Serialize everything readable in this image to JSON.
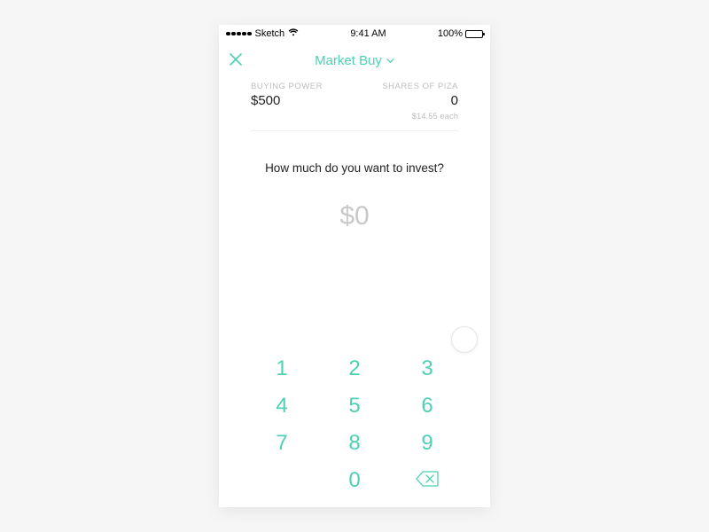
{
  "colors": {
    "accent": "#4ed1b3"
  },
  "status": {
    "carrier": "Sketch",
    "time": "9:41 AM",
    "battery": "100%"
  },
  "nav": {
    "title": "Market Buy"
  },
  "buying_power": {
    "label": "BUYING POWER",
    "value": "$500"
  },
  "shares": {
    "label": "SHARES OF PIZA",
    "value": "0",
    "price_each": "$14.55 each"
  },
  "prompt": "How much do you want to invest?",
  "amount_display": "$0",
  "keypad": {
    "keys": [
      "1",
      "2",
      "3",
      "4",
      "5",
      "6",
      "7",
      "8",
      "9",
      "",
      "0"
    ]
  }
}
